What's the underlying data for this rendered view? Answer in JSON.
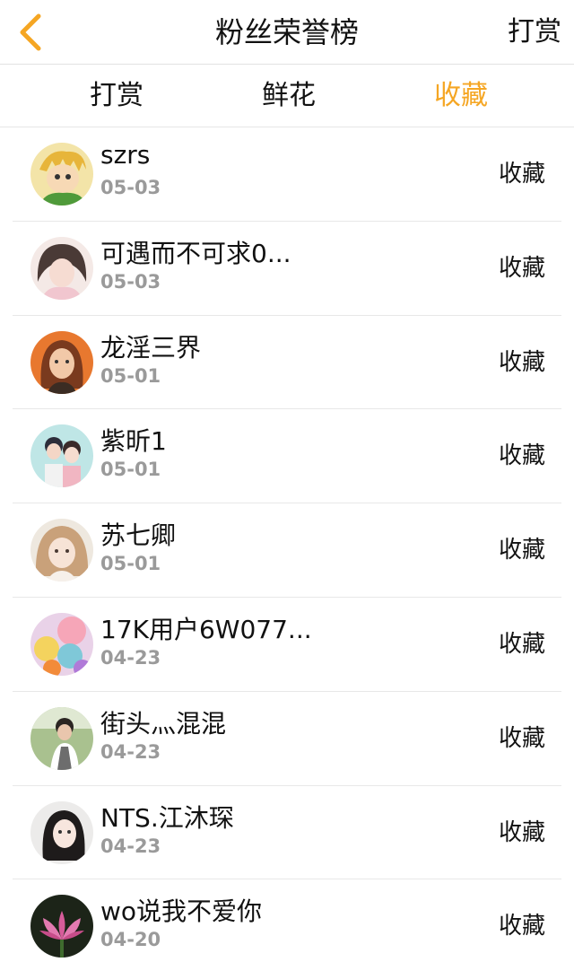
{
  "navbar": {
    "back_icon": "chevron-left-icon",
    "back_color": "#f5a623",
    "title": "粉丝荣誉榜",
    "action_label": "打赏"
  },
  "tabs": [
    {
      "label": "打赏",
      "active": false
    },
    {
      "label": "鲜花",
      "active": false
    },
    {
      "label": "收藏",
      "active": true
    }
  ],
  "accent_color": "#f5a623",
  "fans": [
    {
      "name": "szrs",
      "date": "05-03",
      "action": "收藏"
    },
    {
      "name": "可遇而不可求0...",
      "date": "05-03",
      "action": "收藏"
    },
    {
      "name": "龙淫三界",
      "date": "05-01",
      "action": "收藏"
    },
    {
      "name": "紫昕1",
      "date": "05-01",
      "action": "收藏"
    },
    {
      "name": "苏七卿",
      "date": "05-01",
      "action": "收藏"
    },
    {
      "name": "17K用户6W077...",
      "date": "04-23",
      "action": "收藏"
    },
    {
      "name": "街头灬混混",
      "date": "04-23",
      "action": "收藏"
    },
    {
      "name": "NTS.江沐琛",
      "date": "04-23",
      "action": "收藏"
    },
    {
      "name": "wo说我不爱你",
      "date": "04-20",
      "action": "收藏"
    }
  ]
}
